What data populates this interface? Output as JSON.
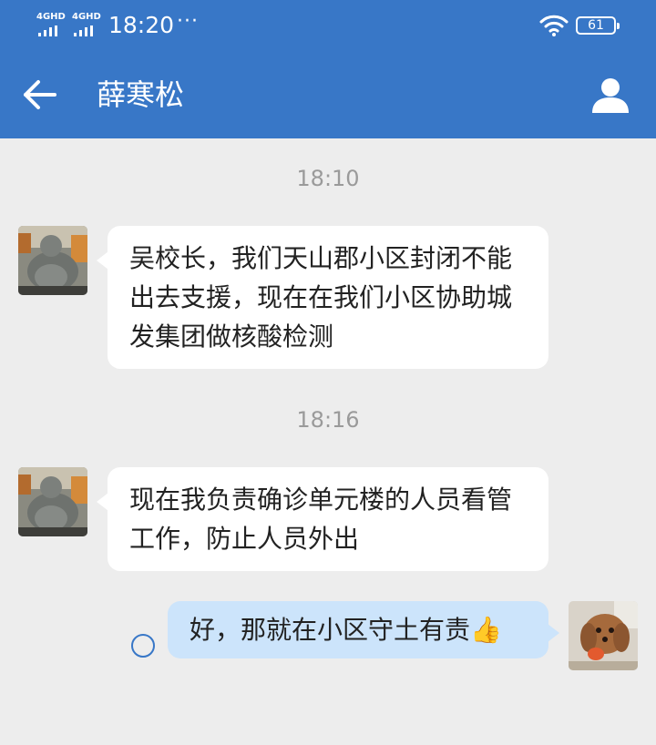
{
  "status_bar": {
    "network_1": "4GHD",
    "network_2": "4GHD",
    "time": "18:20",
    "more": "···",
    "battery": "61"
  },
  "header": {
    "title": "薛寒松"
  },
  "messages": [
    {
      "type": "timestamp",
      "text": "18:10"
    },
    {
      "type": "incoming",
      "text": "吴校长，我们天山郡小区封闭不能出去支援，现在在我们小区协助城发集团做核酸检测"
    },
    {
      "type": "timestamp",
      "text": "18:16"
    },
    {
      "type": "incoming",
      "text": "现在我负责确诊单元楼的人员看管工作，防止人员外出"
    },
    {
      "type": "outgoing",
      "text": "好，那就在小区守土有责",
      "emoji": "👍"
    }
  ],
  "icons": {
    "back": "back-arrow-icon",
    "profile": "person-icon",
    "wifi": "wifi-icon",
    "battery": "battery-icon",
    "read_status": "unread-circle-icon"
  },
  "colors": {
    "header": "#3877c7",
    "background": "#ededed",
    "incoming_bubble": "#ffffff",
    "outgoing_bubble": "#cce4fb"
  }
}
